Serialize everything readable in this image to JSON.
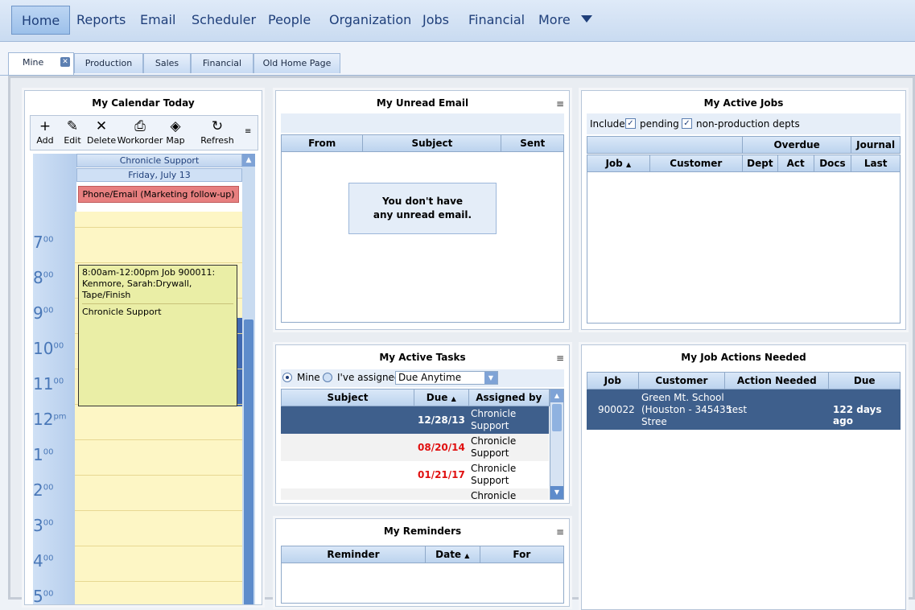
{
  "nav": {
    "items": [
      "Home",
      "Reports",
      "Email",
      "Scheduler",
      "People",
      "Organization",
      "Jobs",
      "Financial",
      "More"
    ],
    "active": "Home"
  },
  "tabs": [
    "Mine",
    "Production",
    "Sales",
    "Financial",
    "Old Home Page"
  ],
  "calendar": {
    "title": "My Calendar Today",
    "toolbar": [
      "Add",
      "Edit",
      "Delete",
      "Workorder",
      "Map",
      "Refresh"
    ],
    "resource": "Chronicle Support",
    "date": "Friday, July 13",
    "allday_event": "Phone/Email (Marketing follow-up)",
    "hours": [
      {
        "h": "7",
        "m": "00"
      },
      {
        "h": "8",
        "m": "00"
      },
      {
        "h": "9",
        "m": "00"
      },
      {
        "h": "10",
        "m": "00"
      },
      {
        "h": "11",
        "m": "00"
      },
      {
        "h": "12",
        "m": "pm"
      },
      {
        "h": "1",
        "m": "00"
      },
      {
        "h": "2",
        "m": "00"
      },
      {
        "h": "3",
        "m": "00"
      },
      {
        "h": "4",
        "m": "00"
      },
      {
        "h": "5",
        "m": "00"
      }
    ],
    "event": {
      "line1": "8:00am-12:00pm Job 900011:",
      "line2": "Kenmore, Sarah:Drywall, Tape/Finish",
      "line3": "Chronicle Support"
    }
  },
  "email": {
    "title": "My Unread Email",
    "columns": [
      "From",
      "Subject",
      "Sent"
    ],
    "empty_line1": "You don't have",
    "empty_line2": "any unread email."
  },
  "jobs": {
    "title": "My Active Jobs",
    "include_label": "Include",
    "pending_label": "pending",
    "nonprod_label": "non-production depts",
    "group_overdue": "Overdue",
    "group_journal": "Journal",
    "columns": [
      "Job",
      "Customer",
      "Dept",
      "Act",
      "Docs",
      "Last"
    ]
  },
  "tasks": {
    "title": "My Active Tasks",
    "mine_label": "Mine",
    "assigned_label": "I've assigned",
    "filter": "Due Anytime",
    "columns": [
      "Subject",
      "Due",
      "Assigned by"
    ],
    "rows": [
      {
        "due": "12/28/13",
        "by1": "Chronicle",
        "by2": "Support"
      },
      {
        "due": "08/20/14",
        "by1": "Chronicle",
        "by2": "Support"
      },
      {
        "due": "01/21/17",
        "by1": "Chronicle",
        "by2": "Support"
      },
      {
        "due": "",
        "by1": "Chronicle",
        "by2": ""
      }
    ]
  },
  "actions": {
    "title": "My Job Actions Needed",
    "columns": [
      "Job",
      "Customer",
      "Action Needed",
      "Due"
    ],
    "row": {
      "job": "900022",
      "cust1": "Green Mt. School",
      "cust2": "(Houston - 345435",
      "cust3": "Stree",
      "action": "test",
      "due": "122 days ago"
    }
  },
  "reminders": {
    "title": "My Reminders",
    "columns": [
      "Reminder",
      "Date",
      "For"
    ]
  },
  "colors": {
    "selected_row": "#3e5f8c",
    "overdue_red": "#e01010",
    "appointment_red": "#e07a7a"
  }
}
